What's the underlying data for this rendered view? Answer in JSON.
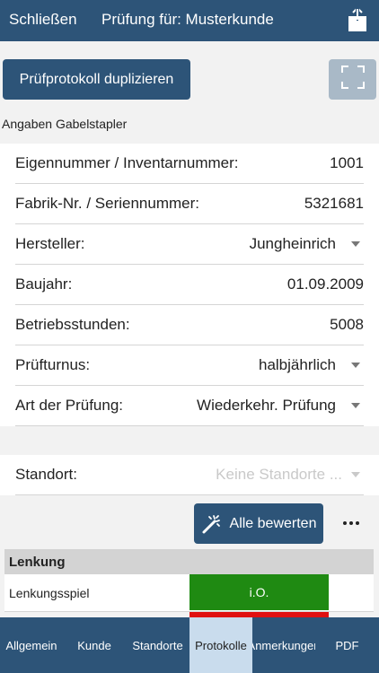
{
  "header": {
    "close_label": "Schließen",
    "title": "Prüfung für: Musterkunde",
    "share_icon": "share-icon"
  },
  "actions": {
    "duplicate_label": "Prüfprotokoll duplizieren",
    "fullscreen_icon": "fullscreen-icon"
  },
  "section": {
    "label": "Angaben Gabelstapler"
  },
  "form": {
    "rows": [
      {
        "label": "Eigennummer / Inventarnummer:",
        "value": "1001",
        "dropdown": false
      },
      {
        "label": "Fabrik-Nr. / Seriennummer:",
        "value": "5321681",
        "dropdown": false
      },
      {
        "label": "Hersteller:",
        "value": "Jungheinrich",
        "dropdown": true
      },
      {
        "label": "Baujahr:",
        "value": "01.09.2009",
        "dropdown": false
      },
      {
        "label": "Betriebsstunden:",
        "value": "5008",
        "dropdown": false
      },
      {
        "label": "Prüfturnus:",
        "value": "halbjährlich",
        "dropdown": true
      },
      {
        "label": "Art der Prüfung:",
        "value": "Wiederkehr. Prüfung",
        "dropdown": true
      }
    ]
  },
  "standort": {
    "label": "Standort:",
    "value": "Keine Standorte ..."
  },
  "rating": {
    "rate_all_label": "Alle bewerten",
    "more_icon": "more-icon"
  },
  "checklist": {
    "group_title": "Lenkung",
    "items": [
      {
        "label": "Lenkungsspiel",
        "status": "i.O.",
        "status_color": "#1f8a12"
      }
    ]
  },
  "tabs": [
    {
      "label": "Allgemein",
      "active": false
    },
    {
      "label": "Kunde",
      "active": false
    },
    {
      "label": "Standorte",
      "active": false
    },
    {
      "label": "Protokolle",
      "active": true
    },
    {
      "label": "Anmerkungen",
      "active": false
    },
    {
      "label": "PDF",
      "active": false
    }
  ],
  "colors": {
    "primary": "#2d5478",
    "ok_green": "#1f8a12",
    "alert_red": "#e01010",
    "tab_active": "#c9dced"
  }
}
